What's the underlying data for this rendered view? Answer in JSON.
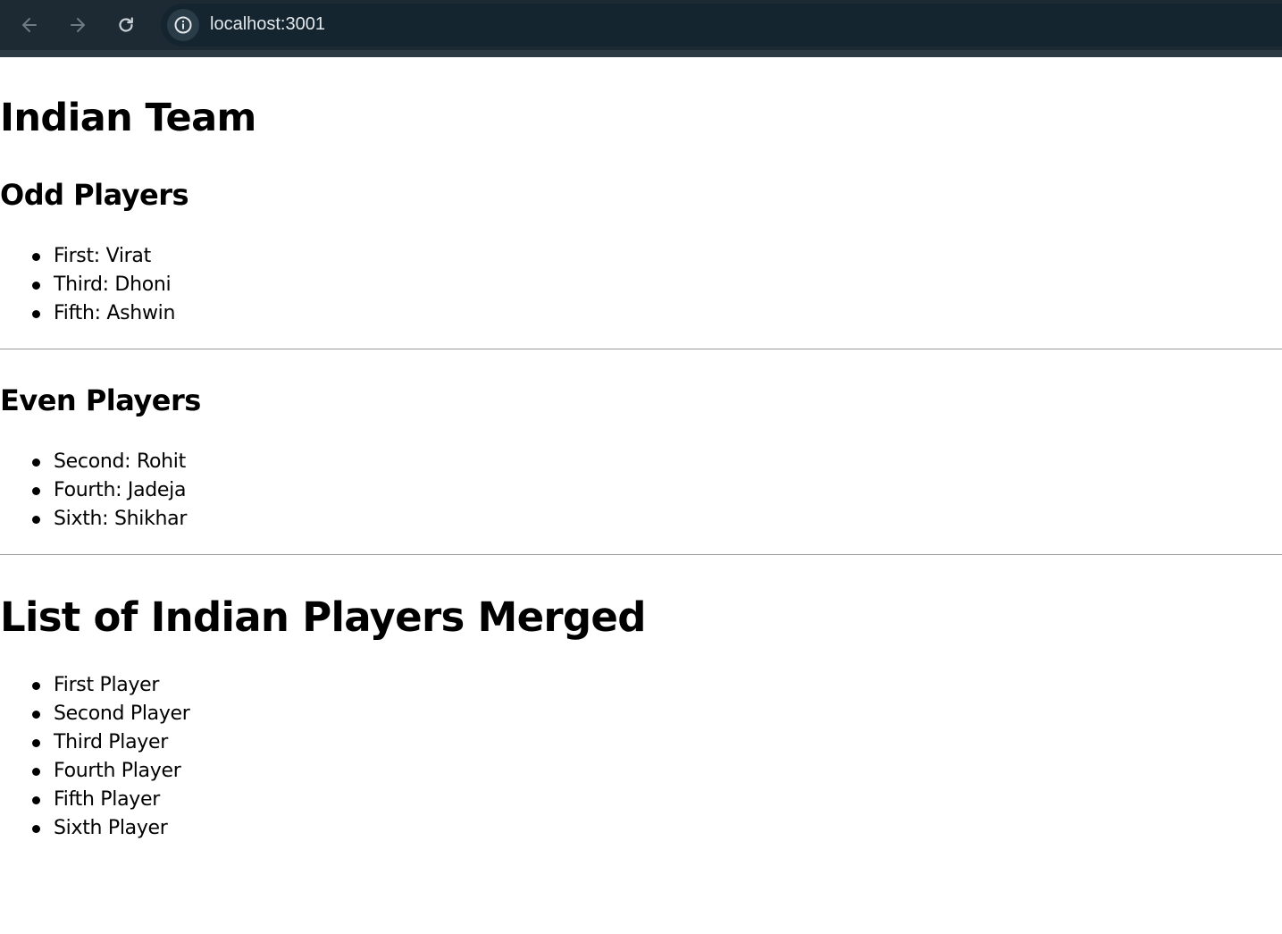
{
  "browser": {
    "url": "localhost:3001",
    "back_icon": "arrow-left-icon",
    "forward_icon": "arrow-right-icon",
    "reload_icon": "reload-icon",
    "info_icon": "info-icon"
  },
  "page": {
    "title": "Indian Team",
    "odd_heading": "Odd Players",
    "odd_players": [
      "First: Virat",
      "Third: Dhoni",
      "Fifth: Ashwin"
    ],
    "even_heading": "Even Players",
    "even_players": [
      "Second: Rohit",
      "Fourth: Jadeja",
      "Sixth: Shikhar"
    ],
    "merged_heading": "List of Indian Players Merged",
    "merged_players": [
      "First Player",
      "Second Player",
      "Third Player",
      "Fourth Player",
      "Fifth Player",
      "Sixth Player"
    ]
  }
}
